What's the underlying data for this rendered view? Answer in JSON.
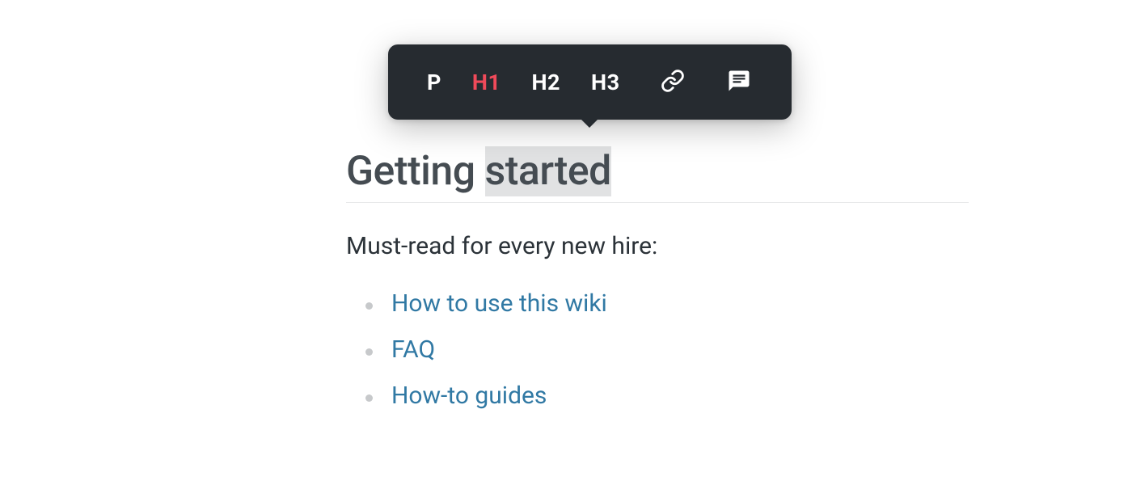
{
  "toolbar": {
    "p_label": "P",
    "h1_label": "H1",
    "h2_label": "H2",
    "h3_label": "H3",
    "active": "h1"
  },
  "heading": {
    "prefix": "Getting ",
    "selected": "started"
  },
  "intro": "Must-read for every new hire:",
  "links": {
    "item1": "How to use this wiki",
    "item2": "FAQ",
    "item3": "How-to guides"
  }
}
